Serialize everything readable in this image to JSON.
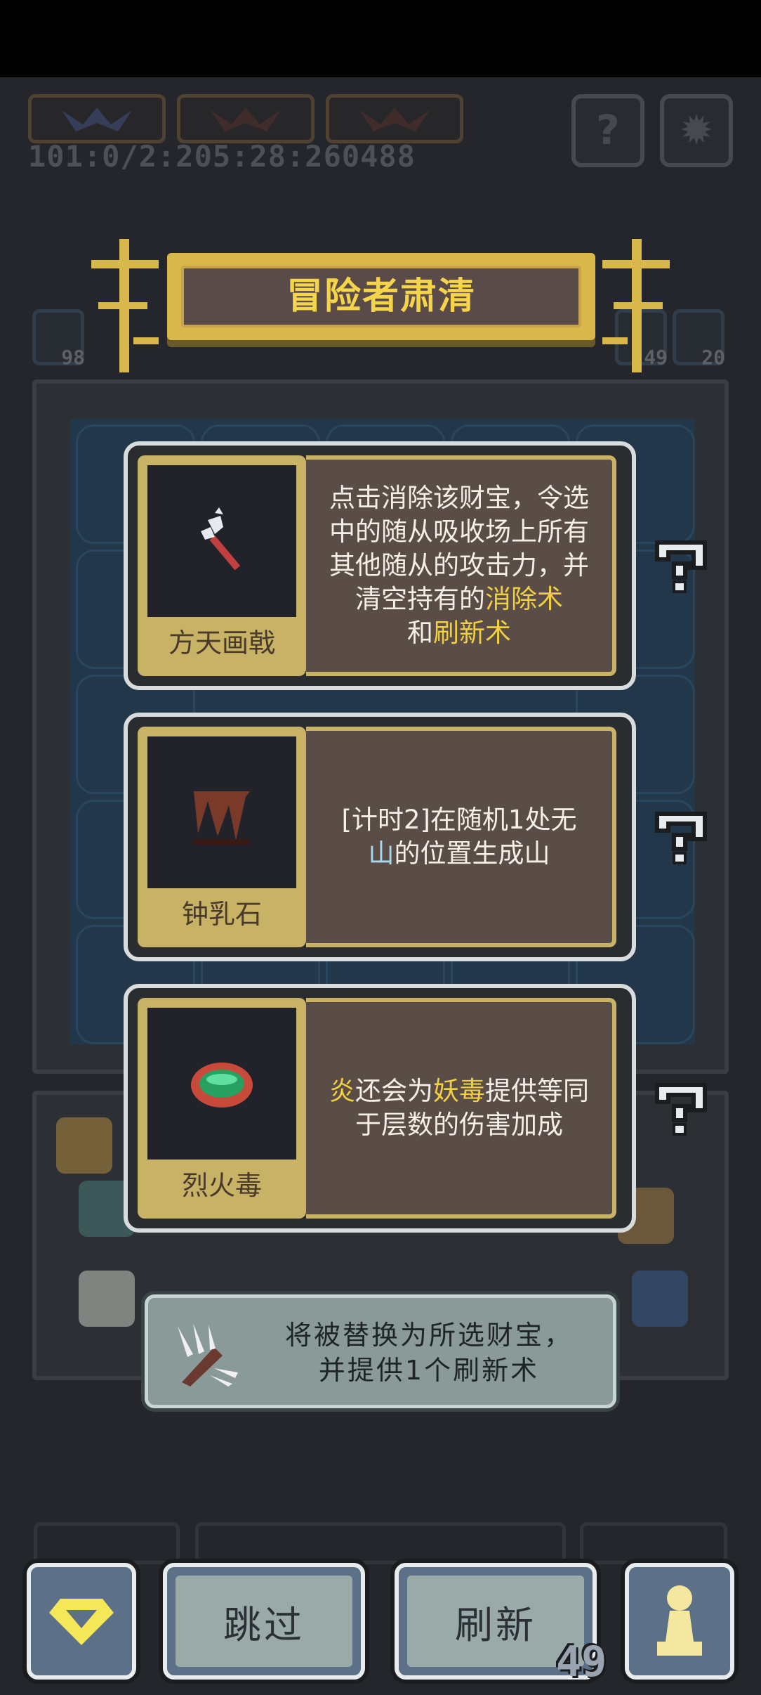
{
  "hud": {
    "seed": "101:0/2:205:28:260488",
    "help_icon": "?",
    "settings_icon": "gear",
    "counters": [
      "98",
      "49",
      "20"
    ]
  },
  "title": "冒险者肃清",
  "cards": [
    {
      "name": "方天画戟",
      "icon": "halberd-icon",
      "desc_parts": [
        {
          "t": "点击消除该财宝，令选中的随从吸收场上所有其他随从的攻击力，并清空持有的",
          "hl": ""
        },
        {
          "t": "消除术",
          "hl": "yellow"
        },
        {
          "t": "和",
          "hl": ""
        },
        {
          "t": "刷新术",
          "hl": "yellow"
        }
      ]
    },
    {
      "name": "钟乳石",
      "icon": "stalactite-icon",
      "desc_parts": [
        {
          "t": "[计时2]在随机1处无",
          "hl": ""
        },
        {
          "t": "山",
          "hl": "blue"
        },
        {
          "t": "的位置生成山",
          "hl": ""
        }
      ]
    },
    {
      "name": "烈火毒",
      "icon": "fire-poison-icon",
      "desc_parts": [
        {
          "t": "炎",
          "hl": "yellow"
        },
        {
          "t": "还会为",
          "hl": ""
        },
        {
          "t": "妖毒",
          "hl": "yellow"
        },
        {
          "t": "提供等同于层数的伤害加成",
          "hl": ""
        }
      ]
    }
  ],
  "toast": {
    "line1": "将被替换为所选财宝，",
    "line2": "并提供1个刷新术",
    "icon": "claw-icon"
  },
  "bottom": {
    "skip_label": "跳过",
    "refresh_label": "刷新",
    "refresh_count": "49",
    "left_icon": "gem-icon",
    "right_icon": "pawn-icon"
  },
  "colors": {
    "highlight_yellow": "#f0d040",
    "highlight_blue": "#a8d8f0",
    "banner_gold": "#d8b84a"
  }
}
